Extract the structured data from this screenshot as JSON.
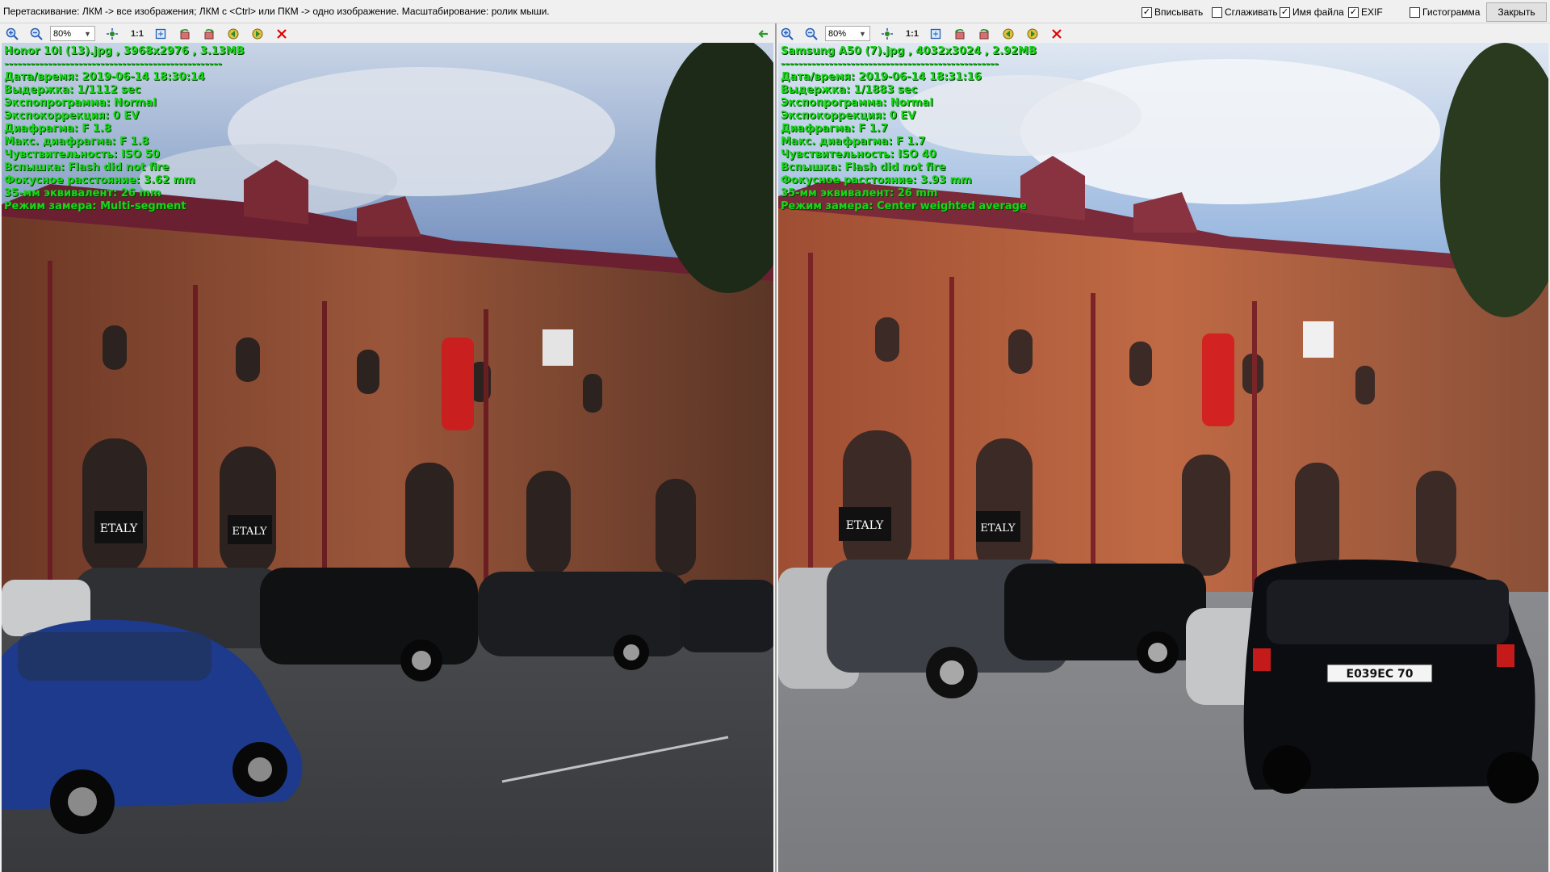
{
  "topbar": {
    "hint": "Перетаскивание: ЛКМ -> все изображения; ЛКМ с <Ctrl> или ПКМ -> одно изображение. Масштабирование: ролик мыши.",
    "options": [
      {
        "label": "Вписывать",
        "checked": true
      },
      {
        "label": "Сглаживать",
        "checked": false
      },
      {
        "label": "Имя файла",
        "checked": true
      },
      {
        "label": "EXIF",
        "checked": true
      },
      {
        "label": "Гистограмма",
        "checked": false
      }
    ],
    "close_label": "Закрыть"
  },
  "toolbar": {
    "icons": [
      "zoom-in-icon",
      "zoom-out-icon",
      "fit-icon",
      "actual-size-icon",
      "fit-window-icon",
      "rotate-left-icon",
      "rotate-right-icon",
      "prev-image-icon",
      "next-image-icon",
      "close-image-icon"
    ],
    "one_to_one": "1:1"
  },
  "left": {
    "zoom": "80%",
    "file_line": "Honor 10i (13).jpg , 3968x2976 , 3.13MB",
    "separator": "--------------------------------------------------",
    "exif": [
      "Дата/время: 2019-06-14 18:30:14",
      "Выдержка: 1/1112 sec",
      "Экспопрограмма: Normal",
      "Экспокоррекция: 0 EV",
      "Диафрагма: F 1.8",
      "Макс. диафрагма: F 1.8",
      "Чувствительность: ISO 50",
      "Вспышка: Flash did not fire",
      "Фокусное расстояние: 3.62 mm",
      "35-мм эквивалент: 26 mm",
      "Режим замера: Multi-segment"
    ]
  },
  "right": {
    "zoom": "80%",
    "file_line": "Samsung A50 (7).jpg , 4032x3024 , 2.92MB",
    "separator": "--------------------------------------------------",
    "exif": [
      "Дата/время: 2019-06-14 18:31:16",
      "Выдержка: 1/1883 sec",
      "Экспопрограмма: Normal",
      "Экспокоррекция: 0 EV",
      "Диафрагма: F 1.7",
      "Макс. диафрагма: F 1.7",
      "Чувствительность: ISO 40",
      "Вспышка: Flash did not fire",
      "Фокусное расстояние: 3.93 mm",
      "35-мм эквивалент: 26 mm",
      "Режим замера: Center weighted average"
    ],
    "sign_text": "ETALY",
    "plate_text": "E039EC 70"
  },
  "scene_sign_text": "ETALY",
  "colors": {
    "exif_text": "#19d619",
    "brick_left": "#8a4a33",
    "brick_right": "#b9613f",
    "sky_left": "#6f8fbf",
    "sky_right": "#8fb4e0",
    "close_icon": "#e00000"
  }
}
